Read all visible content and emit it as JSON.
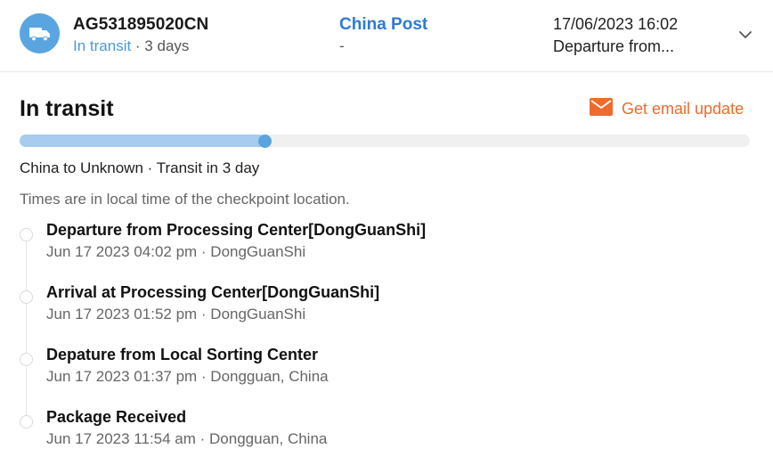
{
  "shipment": {
    "tracking_number": "AG531895020CN",
    "status": "In transit",
    "duration": " · 3 days",
    "icon": "truck-icon"
  },
  "carrier": {
    "name": "China Post",
    "sub": "-"
  },
  "latest": {
    "time": "17/06/2023 16:02",
    "event": "Departure from..."
  },
  "detail": {
    "title": "In transit",
    "email_label": "Get email update",
    "progress_fraction": 0.337,
    "route": "China to Unknown · Transit in 3 day",
    "note": "Times are in local time of the checkpoint location."
  },
  "events": [
    {
      "title": "Departure from Processing Center[DongGuanShi]",
      "meta": "Jun 17 2023 04:02 pm · DongGuanShi"
    },
    {
      "title": "Arrival at Processing Center[DongGuanShi]",
      "meta": "Jun 17 2023 01:52 pm · DongGuanShi"
    },
    {
      "title": "Depature from Local Sorting Center",
      "meta": "Jun 17 2023 01:37 pm · Dongguan, China"
    },
    {
      "title": "Package Received",
      "meta": "Jun 17 2023 11:54 am · Dongguan, China"
    }
  ],
  "colors": {
    "accent_blue": "#5aa5e0",
    "carrier_blue": "#2f7ad3",
    "email_orange": "#ef6a2e",
    "progress_fill": "#a7ccef"
  }
}
